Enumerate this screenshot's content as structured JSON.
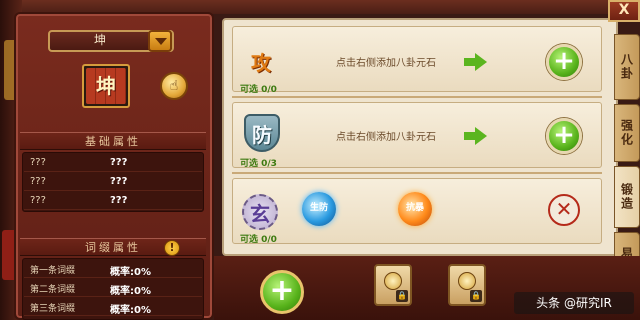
{
  "trigram_selector": {
    "value": "坤"
  },
  "stone": {
    "glyph": "坤"
  },
  "basic_attributes": {
    "title": "基础属性",
    "rows": [
      {
        "key": "???",
        "value": "???"
      },
      {
        "key": "???",
        "value": "???"
      },
      {
        "key": "???",
        "value": "???"
      }
    ]
  },
  "extra_attributes": {
    "title": "词缀属性",
    "rows": [
      {
        "key": "第一条词缀",
        "value": "概率:0%"
      },
      {
        "key": "第二条词缀",
        "value": "概率:0%"
      },
      {
        "key": "第三条词缀",
        "value": "概率:0%"
      }
    ]
  },
  "slots": [
    {
      "glyph": "攻",
      "count": "可选 0/0",
      "hint": "点击右侧添加八卦元石"
    },
    {
      "glyph": "防",
      "count": "可选 0/3",
      "hint": "点击右侧添加八卦元石"
    },
    {
      "glyph": "玄",
      "count": "可选 0/0",
      "orb_1": "生防",
      "orb_2": "抗暴"
    }
  ],
  "tabs": [
    {
      "label": "八卦"
    },
    {
      "label": "强化"
    },
    {
      "label": "锻造"
    },
    {
      "label": "易略"
    }
  ],
  "close_label": "X",
  "watermark": "头条 @研究IR",
  "colors": {
    "panel_red": "#7a2b1e",
    "panel_cream": "#efe4cf",
    "accent_green": "#58b31b",
    "accent_gold": "#e4a93a"
  }
}
